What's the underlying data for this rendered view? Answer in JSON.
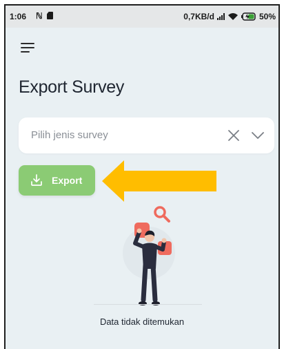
{
  "status_bar": {
    "time": "1:06",
    "network_speed": "0,7KB/d",
    "battery_percent": "50%",
    "icons": [
      "notification-icon",
      "sd-card-icon",
      "signal-icon",
      "wifi-icon",
      "battery-charging-icon"
    ]
  },
  "header": {
    "menu_icon": "hamburger-menu-icon",
    "title": "Export Survey"
  },
  "survey_select": {
    "placeholder": "Pilih jenis survey",
    "clear_icon": "close-icon",
    "dropdown_icon": "chevron-down-icon"
  },
  "export_button": {
    "label": "Export",
    "icon": "download-icon",
    "color": "#8bcb74"
  },
  "annotation": {
    "arrow_color": "#ffbd00",
    "icon": "left-arrow-icon"
  },
  "empty_state": {
    "message": "Data tidak ditemukan",
    "illustration": "person-searching-illustration"
  }
}
